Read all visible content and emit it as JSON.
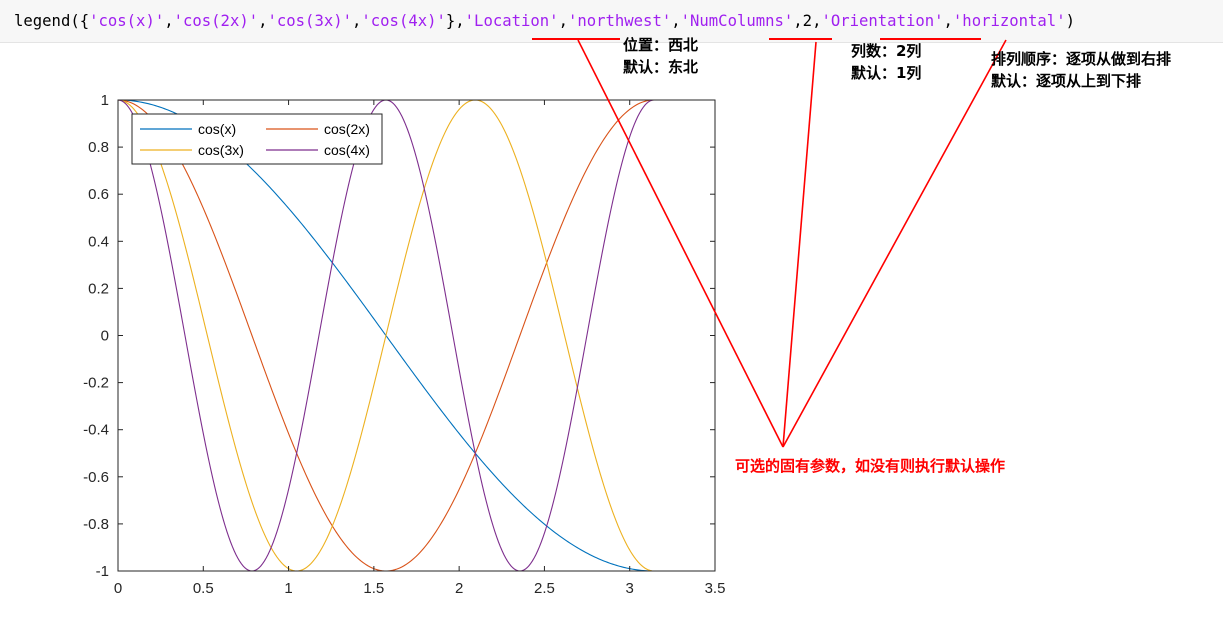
{
  "code": {
    "func": "legend(",
    "parts": [
      {
        "t": "{",
        "s": false
      },
      {
        "t": "'cos(x)'",
        "s": true
      },
      {
        "t": ",",
        "s": false
      },
      {
        "t": "'cos(2x)'",
        "s": true
      },
      {
        "t": ",",
        "s": false
      },
      {
        "t": "'cos(3x)'",
        "s": true
      },
      {
        "t": ",",
        "s": false
      },
      {
        "t": "'cos(4x)'",
        "s": true
      },
      {
        "t": "},",
        "s": false
      },
      {
        "t": "'Location'",
        "s": true
      },
      {
        "t": ",",
        "s": false
      },
      {
        "t": "'northwest'",
        "s": true
      },
      {
        "t": ",",
        "s": false
      },
      {
        "t": "'NumColumns'",
        "s": true
      },
      {
        "t": ",2,",
        "s": false
      },
      {
        "t": "'Orientation'",
        "s": true
      },
      {
        "t": ",",
        "s": false
      },
      {
        "t": "'horizontal'",
        "s": true
      },
      {
        "t": ")",
        "s": false
      }
    ]
  },
  "annotations": {
    "location": [
      "位置：西北",
      "默认：东北"
    ],
    "numcolumns": [
      "列数：2列",
      "默认：1列"
    ],
    "orientation": [
      "排列顺序：逐项从做到右排",
      "默认：逐项从上到下排"
    ],
    "summary": "可选的固有参数，如没有则执行默认操作",
    "color": "#ff0000"
  },
  "chart_data": {
    "type": "line",
    "xlim": [
      0,
      3.5
    ],
    "ylim": [
      -1,
      1
    ],
    "xticks": [
      "0",
      "0.5",
      "1",
      "1.5",
      "2",
      "2.5",
      "3",
      "3.5"
    ],
    "yticks": [
      "1",
      "0.8",
      "0.6",
      "0.4",
      "0.2",
      "0",
      "-0.2",
      "-0.4",
      "-0.6",
      "-0.8",
      "-1"
    ],
    "x_range": [
      0,
      3.14159
    ],
    "legend": {
      "location": "northwest",
      "columns": 2,
      "orientation": "horizontal"
    },
    "series": [
      {
        "name": "cos(x)",
        "k": 1,
        "color": "#0072bd"
      },
      {
        "name": "cos(2x)",
        "k": 2,
        "color": "#d95319"
      },
      {
        "name": "cos(3x)",
        "k": 3,
        "color": "#edb120"
      },
      {
        "name": "cos(4x)",
        "k": 4,
        "color": "#7e2f8e"
      }
    ]
  }
}
